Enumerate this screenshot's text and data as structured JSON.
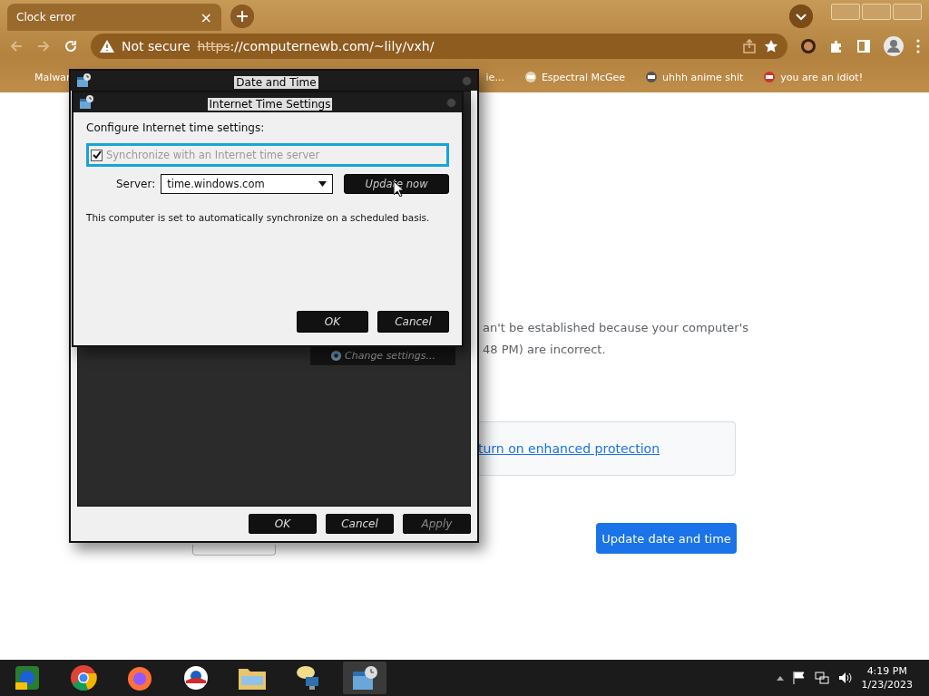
{
  "browser": {
    "tab": {
      "title": "Clock error",
      "close": "×"
    },
    "security": "Not secure",
    "url_scheme": "https",
    "url_rest": "://computernewb.com/~lily/vxh/",
    "bookmarks": [
      {
        "label": "Malwar"
      },
      {
        "label": "ie..."
      },
      {
        "label": "Espectral McGee"
      },
      {
        "label": "uhhh anime shit"
      },
      {
        "label": "you are an idiot!"
      }
    ]
  },
  "page": {
    "lines": [
      "an't be established because your computer's",
      "48 PM) are incorrect."
    ],
    "link": "turn on enhanced protection",
    "button": "Update date and time"
  },
  "date_time_window": {
    "title": "Date and Time",
    "change_settings": "Change settings...",
    "buttons": [
      {
        "label": "OK",
        "disabled": false
      },
      {
        "label": "Cancel",
        "disabled": false
      },
      {
        "label": "Apply",
        "disabled": true
      }
    ]
  },
  "internet_time_window": {
    "title": "Internet Time Settings",
    "heading": "Configure Internet time settings:",
    "sync": {
      "label": "Synchronize with an Internet time server",
      "checked": true,
      "disabled": true
    },
    "server_label": "Server:",
    "server": "time.windows.com",
    "update_button": "Update now",
    "status": "This computer is set to automatically synchronize on a scheduled basis.",
    "buttons": [
      {
        "label": "OK",
        "disabled": false
      },
      {
        "label": "Cancel",
        "disabled": false
      }
    ]
  },
  "taskbar": {
    "time": "4:19 PM",
    "date": "1/23/2023"
  }
}
